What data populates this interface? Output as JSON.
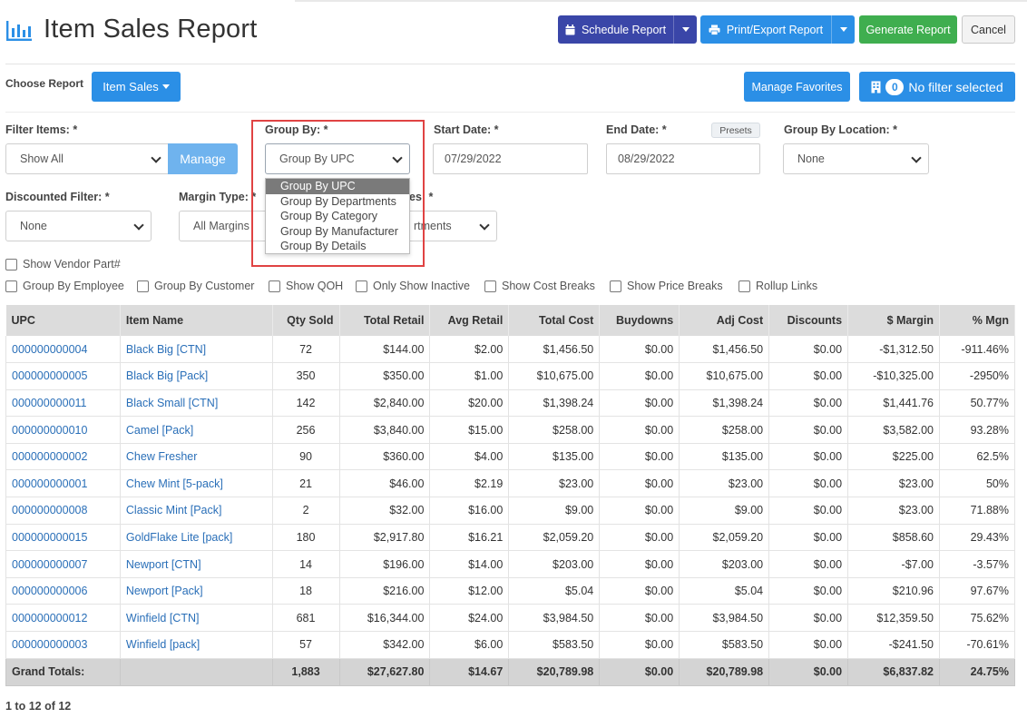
{
  "header": {
    "title": "Item Sales Report",
    "schedule_label": "Schedule Report",
    "print_label": "Print/Export Report",
    "generate_label": "Generate Report",
    "cancel_label": "Cancel"
  },
  "choose": {
    "label": "Choose Report",
    "report_button": "Item Sales",
    "favorites_label": "Manage Favorites",
    "filter_count": "0",
    "filter_label": "No filter selected"
  },
  "filters": {
    "filter_items_label": "Filter Items: *",
    "filter_items_value": "Show All",
    "manage_label": "Manage",
    "group_by_label": "Group By: *",
    "group_by_value": "Group By UPC",
    "group_by_options": [
      "Group By UPC",
      "Group By Departments",
      "Group By Category",
      "Group By Manufacturer",
      "Group By Details"
    ],
    "start_date_label": "Start Date: *",
    "start_date_value": "07/29/2022",
    "end_date_label": "End Date: *",
    "end_date_value": "08/29/2022",
    "presets_label": "Presets",
    "location_label": "Group By Location: *",
    "location_value": "None",
    "discounted_label": "Discounted Filter: *",
    "discounted_value": "None",
    "margin_label": "Margin Type: *",
    "margin_value": "All Margins",
    "dept_label_fragment": "es: *",
    "dept_value_fragment": "rtments"
  },
  "checkboxes": [
    "Show Vendor Part#",
    "Group By Employee",
    "Group By Customer",
    "Show QOH",
    "Only Show Inactive",
    "Show Cost Breaks",
    "Show Price Breaks",
    "Rollup Links"
  ],
  "table": {
    "columns": [
      "UPC",
      "Item Name",
      "Qty Sold",
      "Total Retail",
      "Avg Retail",
      "Total Cost",
      "Buydowns",
      "Adj Cost",
      "Discounts",
      "$ Margin",
      "% Mgn"
    ],
    "rows": [
      [
        "000000000004",
        "Black Big [CTN]",
        "72",
        "$144.00",
        "$2.00",
        "$1,456.50",
        "$0.00",
        "$1,456.50",
        "$0.00",
        "-$1,312.50",
        "-911.46%"
      ],
      [
        "000000000005",
        "Black Big [Pack]",
        "350",
        "$350.00",
        "$1.00",
        "$10,675.00",
        "$0.00",
        "$10,675.00",
        "$0.00",
        "-$10,325.00",
        "-2950%"
      ],
      [
        "000000000011",
        "Black Small [CTN]",
        "142",
        "$2,840.00",
        "$20.00",
        "$1,398.24",
        "$0.00",
        "$1,398.24",
        "$0.00",
        "$1,441.76",
        "50.77%"
      ],
      [
        "000000000010",
        "Camel [Pack]",
        "256",
        "$3,840.00",
        "$15.00",
        "$258.00",
        "$0.00",
        "$258.00",
        "$0.00",
        "$3,582.00",
        "93.28%"
      ],
      [
        "000000000002",
        "Chew Fresher",
        "90",
        "$360.00",
        "$4.00",
        "$135.00",
        "$0.00",
        "$135.00",
        "$0.00",
        "$225.00",
        "62.5%"
      ],
      [
        "000000000001",
        "Chew Mint [5-pack]",
        "21",
        "$46.00",
        "$2.19",
        "$23.00",
        "$0.00",
        "$23.00",
        "$0.00",
        "$23.00",
        "50%"
      ],
      [
        "000000000008",
        "Classic Mint [Pack]",
        "2",
        "$32.00",
        "$16.00",
        "$9.00",
        "$0.00",
        "$9.00",
        "$0.00",
        "$23.00",
        "71.88%"
      ],
      [
        "000000000015",
        "GoldFlake Lite [pack]",
        "180",
        "$2,917.80",
        "$16.21",
        "$2,059.20",
        "$0.00",
        "$2,059.20",
        "$0.00",
        "$858.60",
        "29.43%"
      ],
      [
        "000000000007",
        "Newport [CTN]",
        "14",
        "$196.00",
        "$14.00",
        "$203.00",
        "$0.00",
        "$203.00",
        "$0.00",
        "-$7.00",
        "-3.57%"
      ],
      [
        "000000000006",
        "Newport [Pack]",
        "18",
        "$216.00",
        "$12.00",
        "$5.04",
        "$0.00",
        "$5.04",
        "$0.00",
        "$210.96",
        "97.67%"
      ],
      [
        "000000000012",
        "Winfield [CTN]",
        "681",
        "$16,344.00",
        "$24.00",
        "$3,984.50",
        "$0.00",
        "$3,984.50",
        "$0.00",
        "$12,359.50",
        "75.62%"
      ],
      [
        "000000000003",
        "Winfield [pack]",
        "57",
        "$342.00",
        "$6.00",
        "$583.50",
        "$0.00",
        "$583.50",
        "$0.00",
        "-$241.50",
        "-70.61%"
      ]
    ],
    "totals": [
      "Grand Totals:",
      "",
      "1,883",
      "$27,627.80",
      "$14.67",
      "$20,789.98",
      "$0.00",
      "$20,789.98",
      "$0.00",
      "$6,837.82",
      "24.75%"
    ]
  },
  "pager": "1 to 12 of 12",
  "colors": {
    "schedule": "#3a46a8",
    "primary": "#2b8fe6",
    "success": "#3fae4f",
    "link": "#2a6fb8",
    "highlight": "#e04343"
  },
  "icons": {
    "title": "bar-chart-icon",
    "schedule": "calendar-icon",
    "print": "printer-icon",
    "filter": "building-icon"
  }
}
